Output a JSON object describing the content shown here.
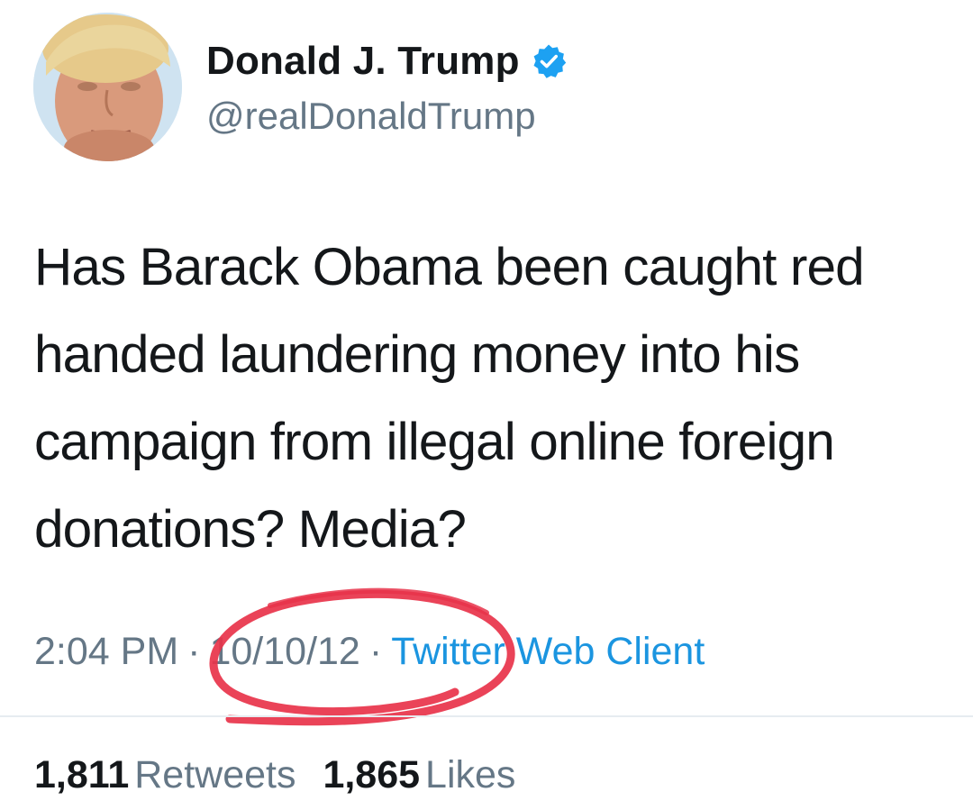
{
  "author": {
    "display_name": "Donald J. Trump",
    "handle": "@realDonaldTrump",
    "verified": true,
    "verified_color": "#1da1f2"
  },
  "tweet": {
    "text": "Has Barack Obama been caught red handed laundering money into his campaign from illegal online foreign donations? Media?",
    "time": "2:04 PM",
    "separator": "·",
    "date": "10/10/12",
    "source": "Twitter Web Client"
  },
  "stats": {
    "retweets_count": "1,811",
    "retweets_label": "Retweets",
    "likes_count": "1,865",
    "likes_label": "Likes"
  },
  "colors": {
    "text": "#14171a",
    "secondary": "#657786",
    "link": "#1b95e0",
    "annotation": "#e8334a"
  }
}
